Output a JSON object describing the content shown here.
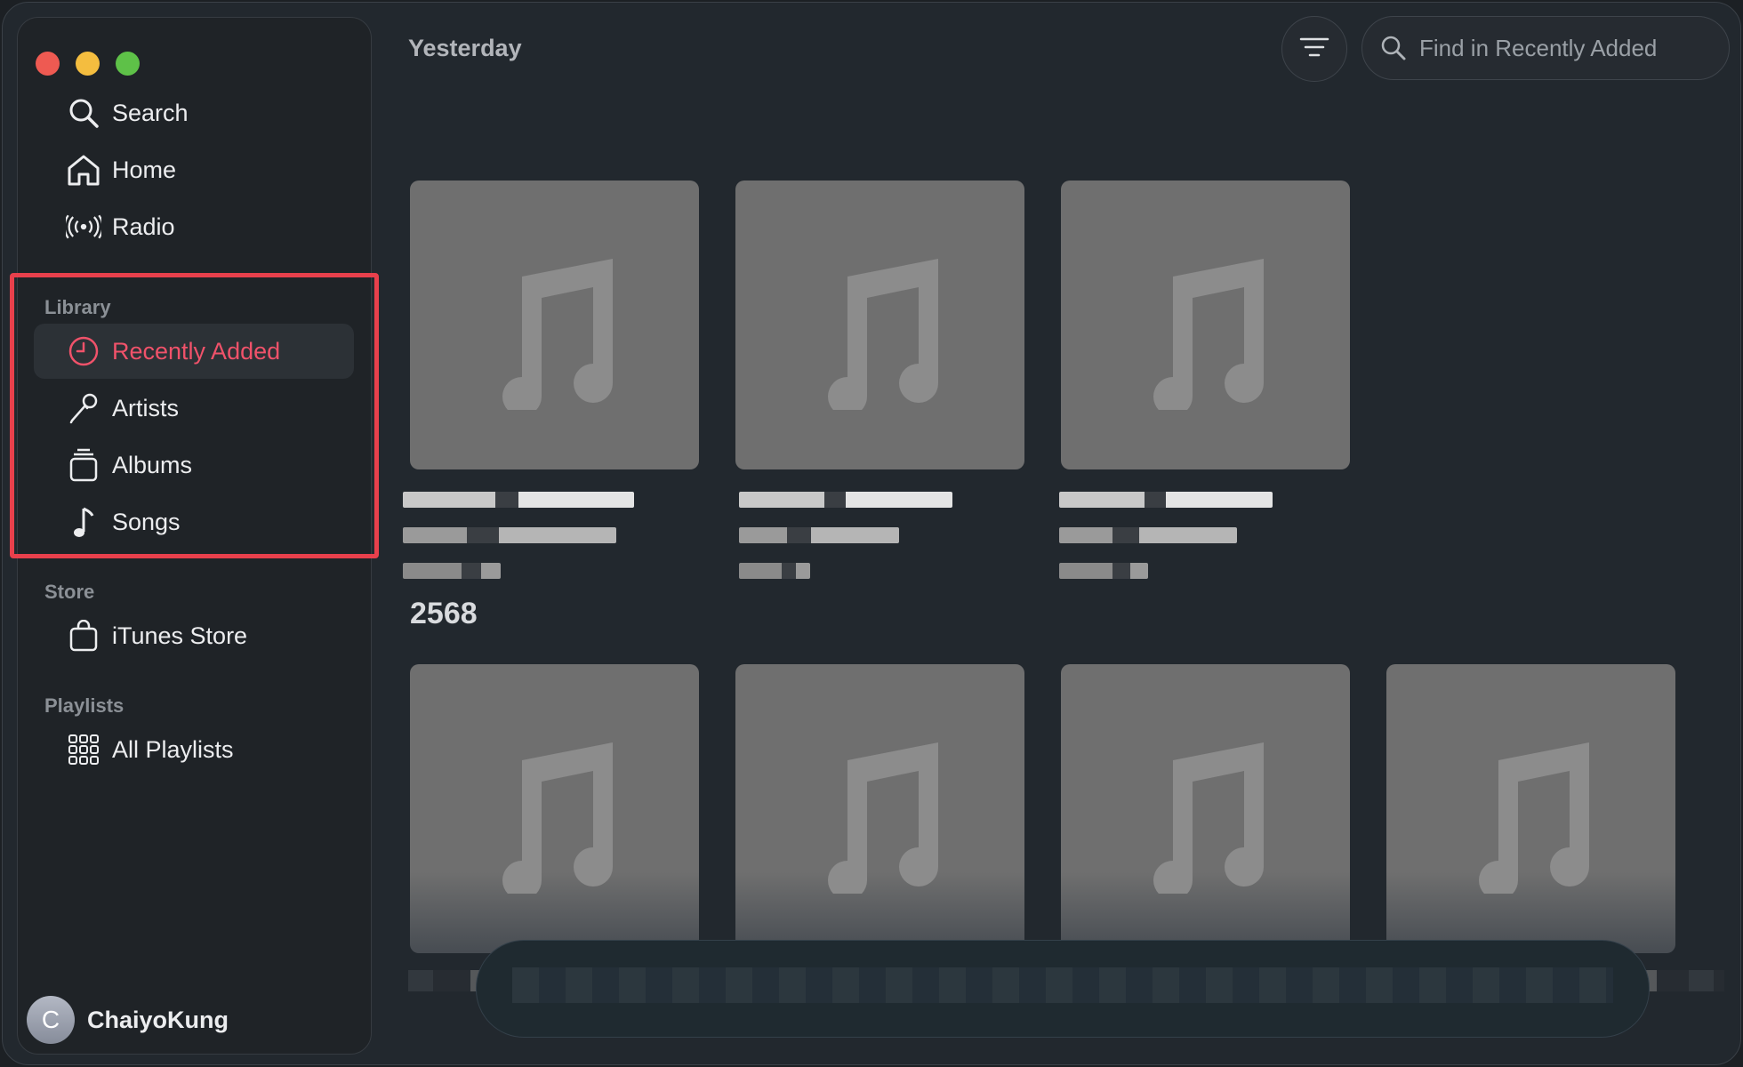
{
  "sidebar": {
    "nav": [
      {
        "label": "Search",
        "icon": "search-icon"
      },
      {
        "label": "Home",
        "icon": "home-icon"
      },
      {
        "label": "Radio",
        "icon": "radio-icon"
      }
    ],
    "library_title": "Library",
    "library": [
      {
        "label": "Recently Added",
        "icon": "clock-icon",
        "active": true
      },
      {
        "label": "Artists",
        "icon": "microphone-icon"
      },
      {
        "label": "Albums",
        "icon": "albums-icon"
      },
      {
        "label": "Songs",
        "icon": "music-note-icon"
      }
    ],
    "store_title": "Store",
    "store": [
      {
        "label": "iTunes Store",
        "icon": "bag-icon"
      }
    ],
    "playlists_title": "Playlists",
    "playlists": [
      {
        "label": "All Playlists",
        "icon": "grid-icon"
      }
    ],
    "user": {
      "initial": "C",
      "name": "ChaiyoKung"
    }
  },
  "main": {
    "section_yesterday": "Yesterday",
    "section_year": "2568",
    "search": {
      "placeholder": "Find in Recently Added"
    }
  },
  "colors": {
    "accent": "#f0526a",
    "highlight": "#e8404c",
    "tile": "#6f6f6f"
  }
}
